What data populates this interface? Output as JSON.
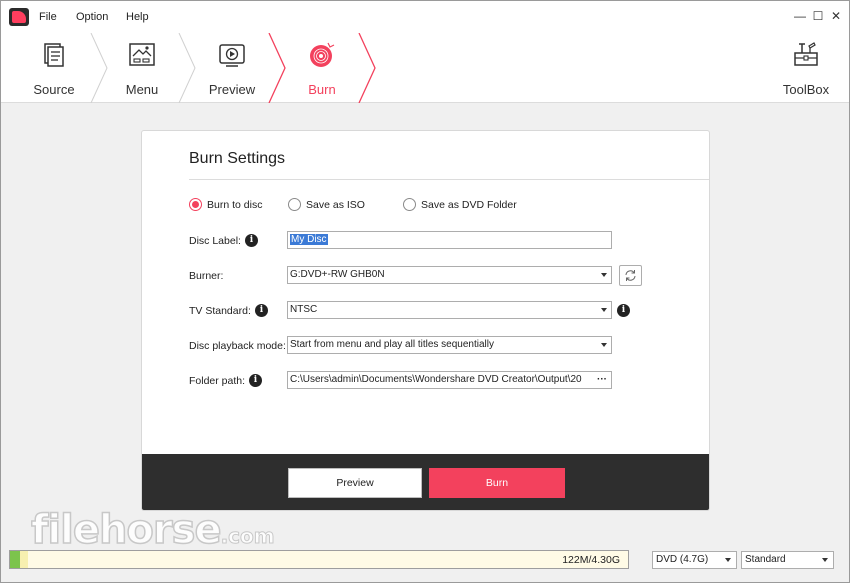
{
  "menu": {
    "file": "File",
    "option": "Option",
    "help": "Help"
  },
  "window_controls": {
    "minimize": "—",
    "maximize": "☐",
    "close": "✕"
  },
  "steps": [
    {
      "label": "Source",
      "icon": "document-icon"
    },
    {
      "label": "Menu",
      "icon": "menu-template-icon"
    },
    {
      "label": "Preview",
      "icon": "preview-player-icon"
    },
    {
      "label": "Burn",
      "icon": "disc-burn-icon",
      "active": true
    }
  ],
  "toolbox": {
    "label": "ToolBox",
    "icon": "toolbox-icon"
  },
  "burn_settings": {
    "title": "Burn Settings",
    "options": {
      "burn_to_disc": "Burn to disc",
      "save_as_iso": "Save as ISO",
      "save_as_folder": "Save as DVD Folder",
      "selected": "Burn to disc"
    },
    "disc_label": {
      "label": "Disc Label:",
      "value": "My Disc"
    },
    "burner": {
      "label": "Burner:",
      "value": "G:DVD+-RW GHB0N"
    },
    "tv_standard": {
      "label": "TV Standard:",
      "value": "NTSC"
    },
    "playback": {
      "label": "Disc playback mode:",
      "value": "Start from menu and play all titles sequentially"
    },
    "folder": {
      "label": "Folder path:",
      "value": "C:\\Users\\admin\\Documents\\Wondershare DVD Creator\\Output\\20"
    },
    "ellipsis": "···",
    "info_glyph": "i"
  },
  "buttons": {
    "preview": "Preview",
    "burn": "Burn"
  },
  "status": {
    "capacity_text": "122M/4.30G",
    "used_fraction": 0.028,
    "disc_type": "DVD (4.7G)",
    "quality": "Standard"
  },
  "watermark": {
    "main": "filehorse",
    "suffix": ".com"
  },
  "colors": {
    "accent": "#f3415d",
    "footer": "#2e2e2e",
    "capacity_used": "#7cc44c"
  }
}
